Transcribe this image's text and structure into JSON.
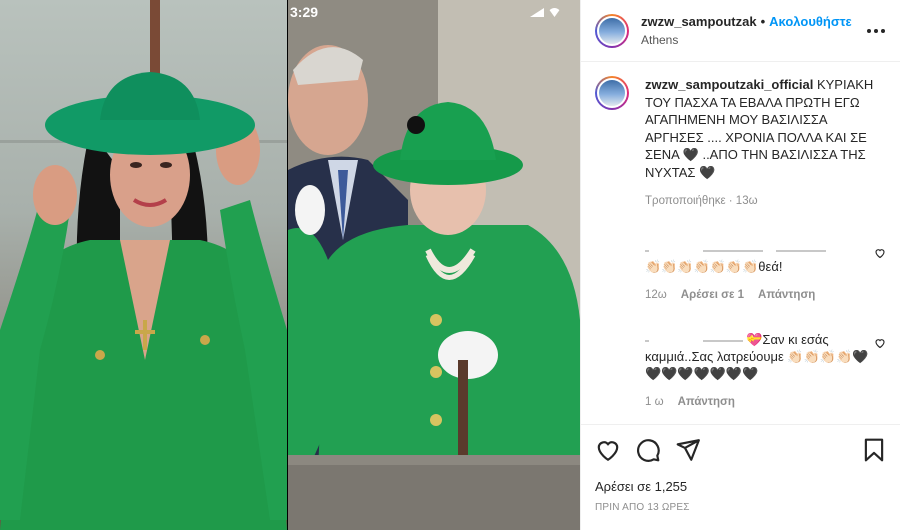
{
  "media": {
    "status_time": "3:29"
  },
  "header": {
    "username": "zwzw_sampoutzak",
    "separator": "•",
    "follow_label": "Ακολουθήστε",
    "location": "Athens"
  },
  "caption": {
    "username": "zwzw_sampoutzaki_official",
    "text": "ΚΥΡΙΑΚΗ ΤΟΥ ΠΑΣΧΑ ΤΑ ΕΒΑΛΑ ΠΡΩΤΗ ΕΓΩ ΑΓΑΠΗΜΕΝΗ ΜΟΥ ΒΑΣΙΛΙΣΣΑ ΑΡΓΗΣΕΣ .... ΧΡΟΝΙΑ ΠΟΛΛΑ ΚΑΙ ΣΕ ΣΕΝΑ 🖤 ..ΑΠΟ ΤΗΝ ΒΑΣΙΛΙΣΣΑ ΤΗΣ ΝΥΧΤΑΣ 🖤",
    "meta": "Τροποποιήθηκε · 13ω"
  },
  "comments": [
    {
      "text": "👏🏻👏🏻👏🏻👏🏻👏🏻👏🏻👏🏻θεά!",
      "time": "12ω",
      "likes": "Αρέσει σε 1",
      "reply": "Απάντηση"
    },
    {
      "text_line1": "💝Σαν κι εσάς",
      "text_line2": "καμμιά..Σας λατρεύουμε 👏🏻👏🏻👏🏻👏🏻🖤",
      "text_line3": "🖤🖤🖤🖤🖤🖤🖤",
      "time": "1 ω",
      "reply": "Απάντηση"
    }
  ],
  "footer": {
    "likes": "Αρέσει σε 1,255",
    "timeago": "ΠΡΙΝ ΑΠΟ 13 ΩΡΕΣ"
  },
  "icons": [
    "more-icon",
    "heart-icon",
    "comment-icon",
    "share-icon",
    "bookmark-icon",
    "like-comment-icon"
  ]
}
